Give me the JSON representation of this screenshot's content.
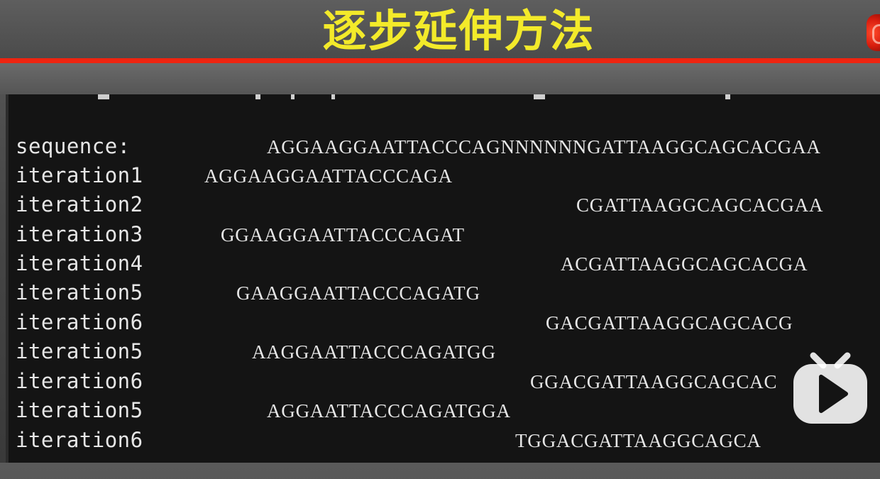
{
  "header": {
    "title": "逐步延伸方法"
  },
  "rows": [
    {
      "label": "sequence:",
      "seq": "AGGAAGGAATTACCCAGNNNNNNGATTAAGGCAGCACGAA"
    },
    {
      "label": "iteration1",
      "seq": "AGGAAGGAATTACCCAGA"
    },
    {
      "label": "iteration2",
      "seq": "CGATTAAGGCAGCACGAA"
    },
    {
      "label": "iteration3",
      "seq": "GGAAGGAATTACCCAGAT"
    },
    {
      "label": "iteration4",
      "seq": "ACGATTAAGGCAGCACGA"
    },
    {
      "label": "iteration5",
      "seq": "GAAGGAATTACCCAGATG"
    },
    {
      "label": "iteration6",
      "seq": "GACGATTAAGGCAGCACG"
    },
    {
      "label": "iteration5",
      "seq": "AAGGAATTACCCAGATGG"
    },
    {
      "label": "iteration6",
      "seq": "GGACGATTAAGGCAGCAC"
    },
    {
      "label": "iteration5",
      "seq": "AGGAATTACCCAGATGGA"
    },
    {
      "label": "iteration6",
      "seq": "TGGACGATTAAGGCAGCA"
    }
  ],
  "overlay": {
    "play_icon": "bilibili-tv-play-icon"
  },
  "colors": {
    "title": "#f3ea2a",
    "accent_line": "#ee2410",
    "terminal_bg": "#141414",
    "text": "#e6e6e6"
  }
}
